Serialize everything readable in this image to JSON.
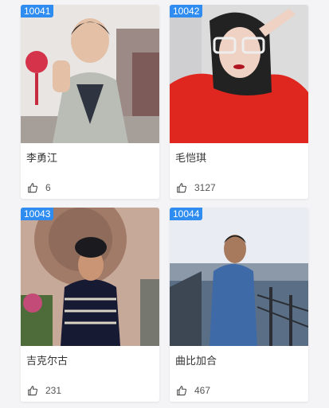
{
  "cards": [
    {
      "id": "10041",
      "name": "李勇江",
      "likes": "6"
    },
    {
      "id": "10042",
      "name": "毛恺琪",
      "likes": "3127"
    },
    {
      "id": "10043",
      "name": "吉克尔古",
      "likes": "231"
    },
    {
      "id": "10044",
      "name": "曲比加合",
      "likes": "467"
    }
  ],
  "icons": {
    "like": "thumbs-up-icon"
  },
  "colors": {
    "badge": "#2f8cf0",
    "background": "#f4f4f6"
  }
}
